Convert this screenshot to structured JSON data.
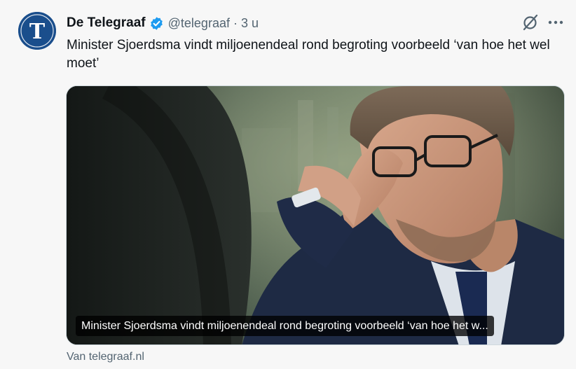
{
  "account": {
    "name": "De Telegraaf",
    "handle": "@telegraaf",
    "separator": "·",
    "time": "3 u",
    "avatar_letter": "T",
    "verified_color": "#1d9bf0",
    "avatar_color": "#1a4e8c"
  },
  "tweet": {
    "text": "Minister Sjoerdsma vindt miljoenendeal rond begroting voorbeeld ‘van hoe het wel moet’"
  },
  "card": {
    "caption": "Minister Sjoerdsma vindt miljoenendeal rond begroting voorbeeld ‘van hoe het w...",
    "source": "Van telegraaf.nl"
  },
  "icons": {
    "avatar": "telegraaf-logo-icon",
    "verified": "verified-badge-icon",
    "grok": "grok-icon",
    "more": "more-icon"
  }
}
